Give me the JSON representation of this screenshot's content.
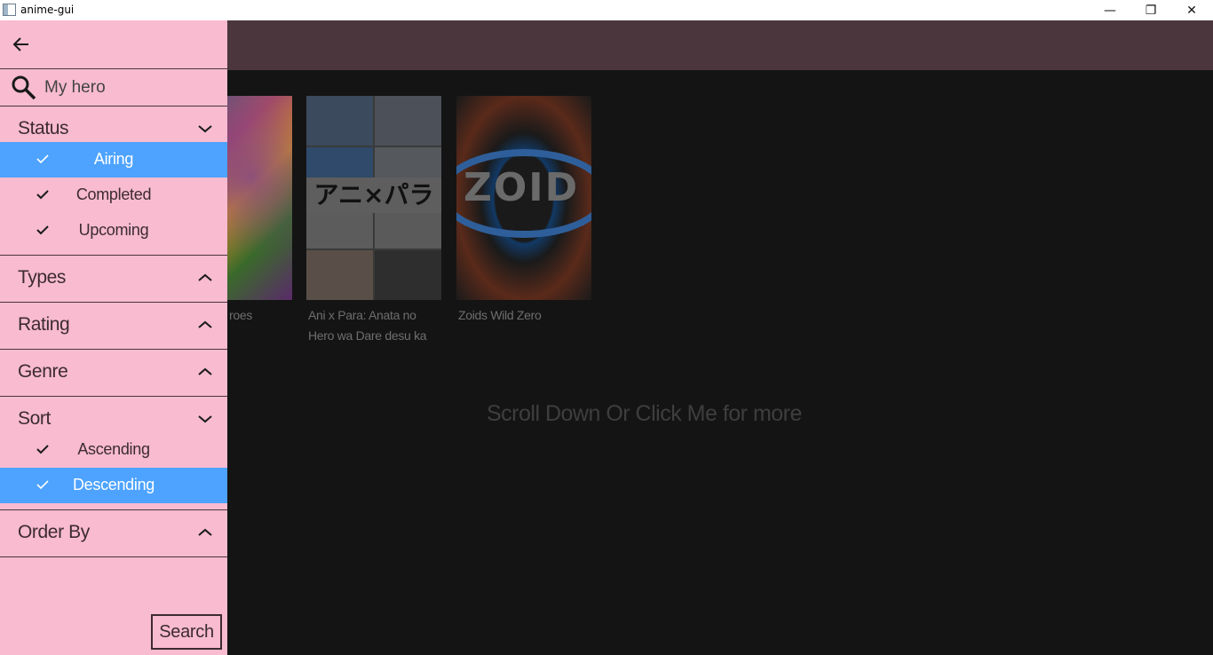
{
  "window": {
    "title": "anime-gui",
    "minimize_glyph": "—",
    "maximize_glyph": "❐",
    "close_glyph": "✕"
  },
  "drawer": {
    "back_icon": "arrow-left-icon",
    "search": {
      "value": "My hero",
      "icon": "search-icon"
    },
    "sections": {
      "status": {
        "label": "Status",
        "expanded": true,
        "options": [
          {
            "label": "Airing",
            "selected": true
          },
          {
            "label": "Completed",
            "selected": false
          },
          {
            "label": "Upcoming",
            "selected": false
          }
        ]
      },
      "types": {
        "label": "Types",
        "expanded": false
      },
      "rating": {
        "label": "Rating",
        "expanded": false
      },
      "genre": {
        "label": "Genre",
        "expanded": false
      },
      "sort": {
        "label": "Sort",
        "expanded": true,
        "options": [
          {
            "label": "Ascending",
            "selected": false
          },
          {
            "label": "Descending",
            "selected": true
          }
        ]
      },
      "order_by": {
        "label": "Order By",
        "expanded": false
      }
    },
    "search_button": "Search"
  },
  "results": {
    "cards": [
      {
        "title": "roes",
        "poster": "poster-1"
      },
      {
        "title": "Ani x Para: Anata no Hero wa Dare desu ka",
        "poster": "poster-2",
        "poster_text": "アニ×パラ"
      },
      {
        "title": "Zoids Wild Zero",
        "poster": "poster-3",
        "poster_text": "ZOID"
      }
    ],
    "more_text": "Scroll Down Or Click Me for more"
  },
  "colors": {
    "drawer_bg": "#f8bbd0",
    "selected_bg": "#4da3ff",
    "appbar_bg": "#4a363c",
    "content_bg": "#141414"
  }
}
